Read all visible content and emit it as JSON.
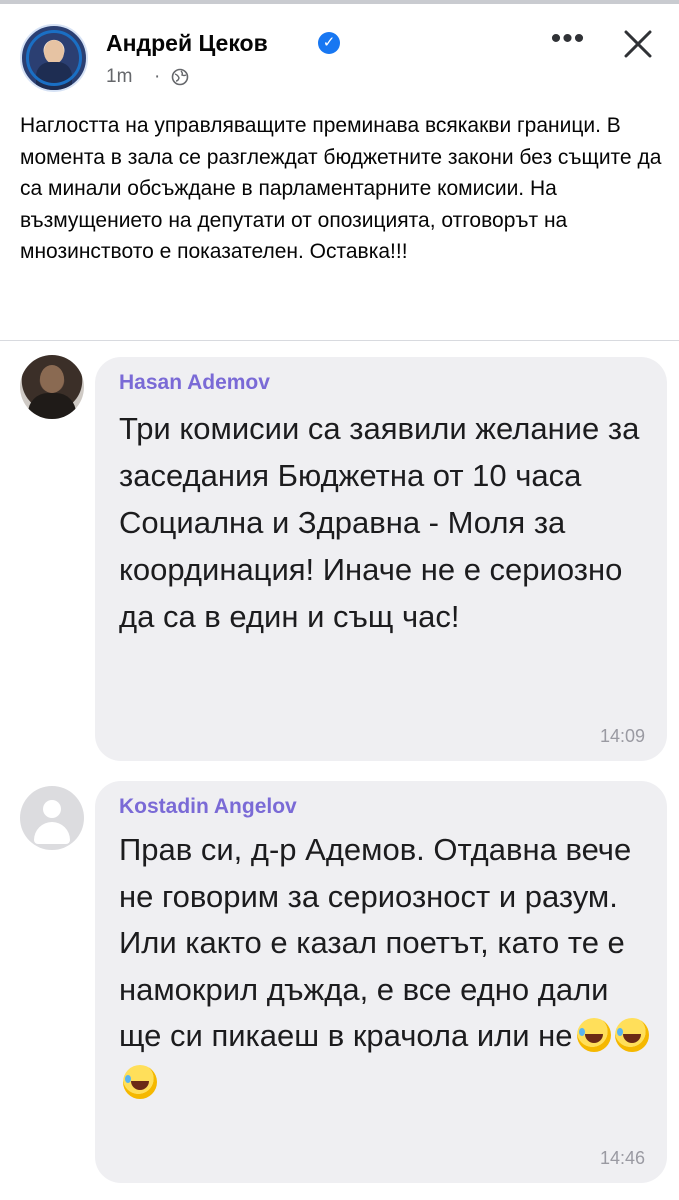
{
  "post": {
    "author": "Андрей Цеков",
    "verified_icon": "verified-badge-icon",
    "time": "1m",
    "separator": "·",
    "privacy_icon": "globe-icon",
    "more_label": "•••",
    "text": "Наглостта на управляващите преминава всякакви граници. В момента в зала се разглеждат бюджетните закони без същите да са минали обсъждане в парламентарните комисии. На възмущението на депутати от опозицията, отговорът на мнозинството е показателен. Оставка!!!"
  },
  "chat": {
    "messages": [
      {
        "sender": "Hasan Ademov",
        "text": "Три комисии са заявили желание за заседания Бюджетна от 10 часа Социална и Здравна - Моля за координация! Иначе не е сериозно да са в един и същ час!",
        "time": "14:09"
      },
      {
        "sender": "Kostadin Angelov",
        "text": "Прав си, д-р Адемов. Отдавна вече не говорим за сериозност и разум. Или както е казал поетът, като те е намокрил дъжда, е все едно дали ще си пикаеш в крачола или не",
        "time": "14:46",
        "emojis": [
          "rolling-on-floor-laughing",
          "rolling-on-floor-laughing",
          "rolling-on-floor-laughing"
        ]
      }
    ]
  },
  "colors": {
    "sender_name": "#7a6ad6",
    "bubble_bg": "#efeff2",
    "verified": "#1877f2"
  }
}
